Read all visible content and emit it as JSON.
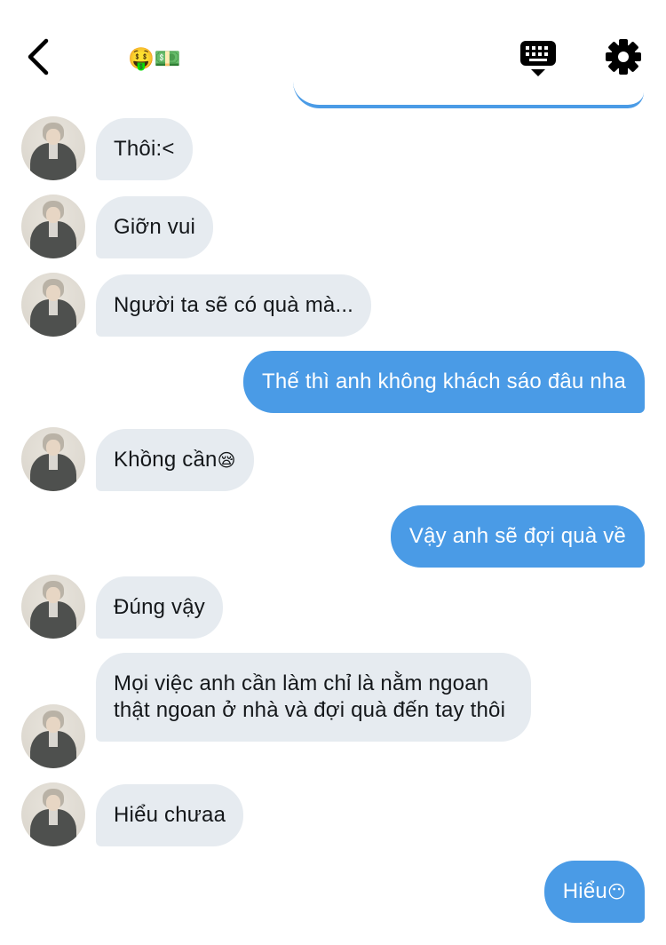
{
  "header": {
    "title": "🤑💵",
    "back_icon": "chevron-left-icon",
    "keyboard_icon": "keyboard-icon",
    "settings_icon": "gear-icon"
  },
  "colors": {
    "outgoing_bubble": "#4a9be6",
    "incoming_bubble": "#e6ebf0",
    "text_dark": "#14171a"
  },
  "messages": [
    {
      "dir": "in",
      "text": "Thôi:<"
    },
    {
      "dir": "in",
      "text": "Giỡn vui"
    },
    {
      "dir": "in",
      "text": "Người ta sẽ có quà mà..."
    },
    {
      "dir": "out",
      "text": "Thế thì anh không khách sáo đâu nha"
    },
    {
      "dir": "in",
      "text": "Khồng cần",
      "emoji": "😪"
    },
    {
      "dir": "out",
      "text": "Vậy anh sẽ đợi quà về"
    },
    {
      "dir": "in",
      "text": "Đúng vậy"
    },
    {
      "dir": "in",
      "text": "Mọi việc anh cần làm chỉ là nằm ngoan thật ngoan ở nhà và đợi quà đến tay thôi"
    },
    {
      "dir": "in",
      "text": "Hiểu chưaa"
    },
    {
      "dir": "out",
      "text": "Hiểu",
      "emoji": "😶"
    }
  ]
}
